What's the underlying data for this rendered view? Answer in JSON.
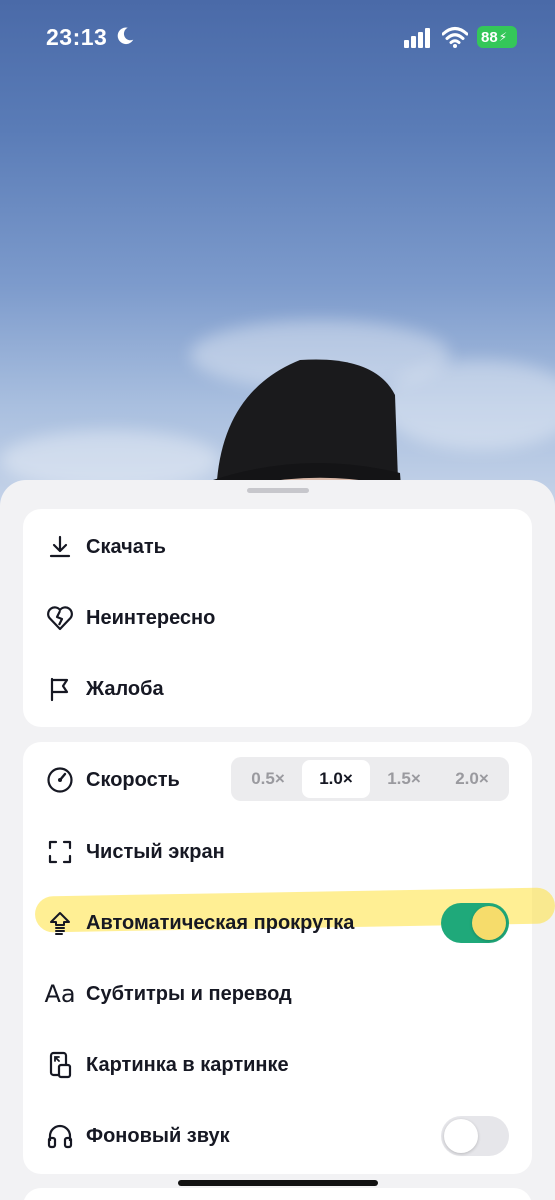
{
  "status_bar": {
    "time": "23:13",
    "battery": "88",
    "icons": [
      "moon-icon",
      "signal-icon",
      "wifi-icon",
      "battery-icon"
    ]
  },
  "menu_primary": {
    "items": [
      {
        "label": "Скачать",
        "icon": "download-icon"
      },
      {
        "label": "Неинтересно",
        "icon": "broken-heart-icon"
      },
      {
        "label": "Жалоба",
        "icon": "flag-icon"
      }
    ]
  },
  "menu_settings": {
    "speed": {
      "label": "Скорость",
      "icon": "speedometer-icon",
      "options": [
        "0.5×",
        "1.0×",
        "1.5×",
        "2.0×"
      ],
      "selected": "1.0×"
    },
    "clear_screen": {
      "label": "Чистый экран",
      "icon": "frame-icon"
    },
    "auto_scroll": {
      "label": "Автоматическая прокрутка",
      "icon": "auto-scroll-icon",
      "enabled": true
    },
    "subtitles": {
      "label": "Субтитры и перевод",
      "icon": "text-aa-icon"
    },
    "pip": {
      "label": "Картинка в картинке",
      "icon": "picture-in-picture-icon"
    },
    "background_audio": {
      "label": "Фоновый звук",
      "icon": "headphones-icon",
      "enabled": false
    }
  },
  "colors": {
    "toggle_on": "#1fa97a",
    "toggle_off": "#e6e6ea",
    "highlight": "#ffe23c",
    "text": "#161823"
  }
}
